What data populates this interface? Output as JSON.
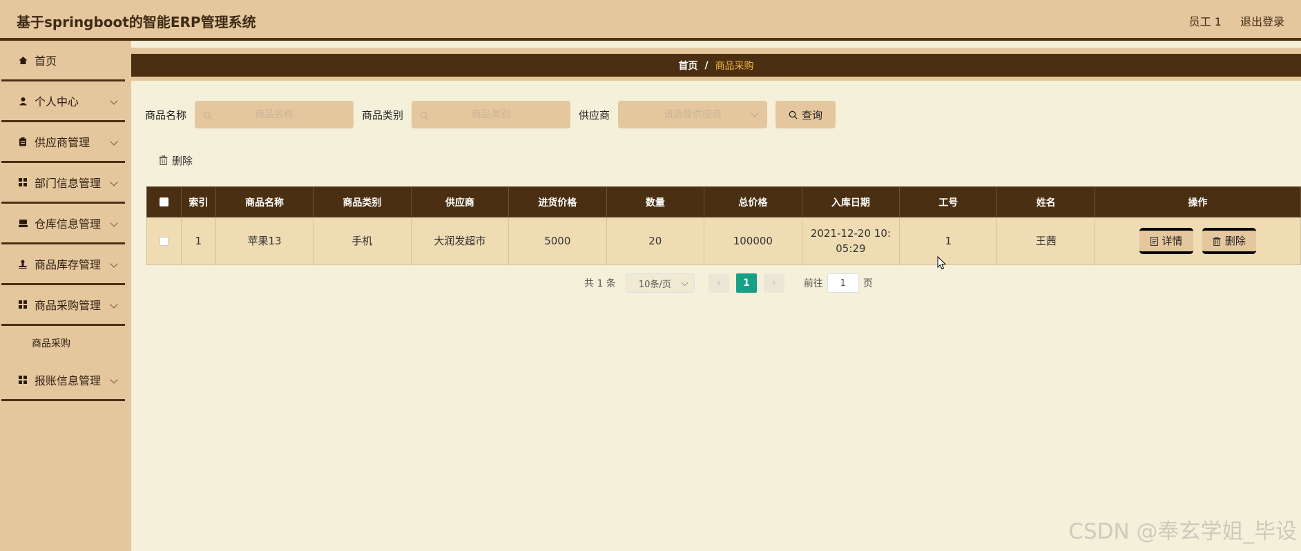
{
  "header": {
    "title": "基于springboot的智能ERP管理系统",
    "user": "员工 1",
    "logout": "退出登录"
  },
  "sidebar": {
    "items": [
      {
        "label": "首页",
        "icon": "home-icon"
      },
      {
        "label": "个人中心",
        "icon": "user-icon"
      },
      {
        "label": "供应商管理",
        "icon": "clipboard-icon"
      },
      {
        "label": "部门信息管理",
        "icon": "grid-icon"
      },
      {
        "label": "仓库信息管理",
        "icon": "warehouse-icon"
      },
      {
        "label": "商品库存管理",
        "icon": "stamp-icon"
      },
      {
        "label": "商品采购管理",
        "icon": "grid-icon"
      },
      {
        "label": "报账信息管理",
        "icon": "grid-icon"
      }
    ],
    "submenu": {
      "label": "商品采购"
    }
  },
  "breadcrumb": {
    "home": "首页",
    "sep": "/",
    "current": "商品采购"
  },
  "search": {
    "name_label": "商品名称",
    "name_placeholder": "商品名称",
    "category_label": "商品类别",
    "category_placeholder": "商品类别",
    "supplier_label": "供应商",
    "supplier_placeholder": "请选择供应商",
    "query_button": "查询"
  },
  "actions": {
    "delete": "删除"
  },
  "table": {
    "headers": [
      "索引",
      "商品名称",
      "商品类别",
      "供应商",
      "进货价格",
      "数量",
      "总价格",
      "入库日期",
      "工号",
      "姓名",
      "操作"
    ],
    "rows": [
      {
        "index": "1",
        "name": "苹果13",
        "category": "手机",
        "supplier": "大润发超市",
        "price": "5000",
        "quantity": "20",
        "total": "100000",
        "date": "2021-12-20 10:05:29",
        "emp_no": "1",
        "emp_name": "王茜",
        "detail_label": "详情",
        "delete_label": "删除"
      }
    ]
  },
  "pagination": {
    "total": "共 1 条",
    "page_size": "10条/页",
    "current_page": "1",
    "goto": "前往",
    "goto_value": "1",
    "page_unit": "页"
  },
  "watermark": "CSDN @奉玄学姐_毕设",
  "colors": {
    "header_bg": "#e5c79e",
    "dark_brown": "#4a2f12",
    "page_bg": "#f5f0da",
    "accent": "#f2b441",
    "pager_active": "#16a085"
  }
}
